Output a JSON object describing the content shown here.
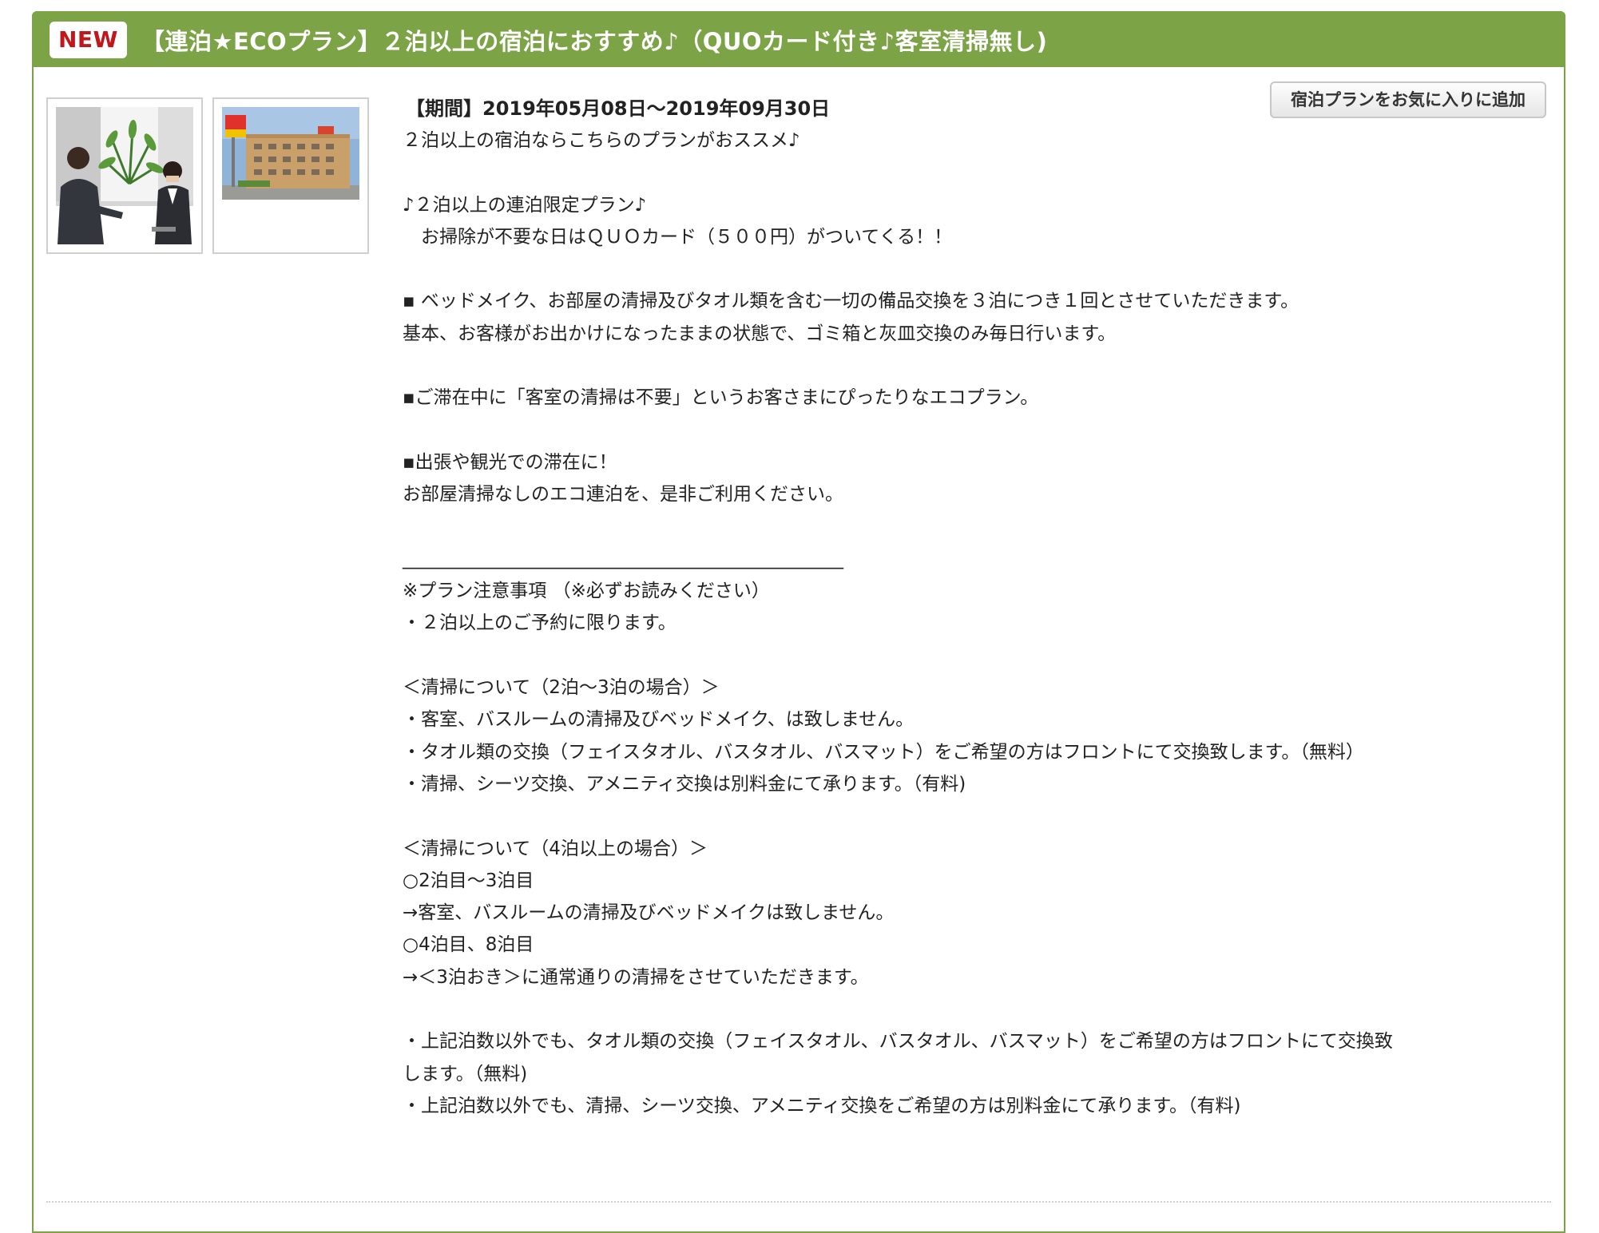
{
  "plan": {
    "badge": "NEW",
    "title": "【連泊★ECOプラン】２泊以上の宿泊におすすめ♪（QUOカード付き♪客室清掃無し)",
    "favorite_button": "宿泊プランをお気に入りに追加",
    "period": "【期間】2019年05月08日〜2019年09月30日",
    "description_lines": [
      "２泊以上の宿泊ならこちらのプランがおススメ♪",
      "",
      "♪２泊以上の連泊限定プラン♪",
      "　お掃除が不要な日はＱＵＯカード（５００円）がついてくる！！",
      "",
      "▪ ベッドメイク、お部屋の清掃及びタオル類を含む一切の備品交換を３泊につき１回とさせていただきます。",
      "基本、お客様がお出かけになったままの状態で、ゴミ箱と灰皿交換のみ毎日行います。",
      "",
      "▪ご滞在中に「客室の清掃は不要」というお客さまにぴったりなエコプラン。",
      "",
      "▪出張や観光での滞在に！",
      "お部屋清掃なしのエコ連泊を、是非ご利用ください。",
      "",
      "________________________________________________",
      "※プラン注意事項 （※必ずお読みください）",
      "・２泊以上のご予約に限ります。",
      "",
      "＜清掃について（2泊〜3泊の場合）＞",
      "・客室、バスルームの清掃及びベッドメイク、は致しません。",
      "・タオル類の交換（フェイスタオル、バスタオル、バスマット）をご希望の方はフロントにて交換致します。（無料）",
      "・清掃、シーツ交換、アメニティ交換は別料金にて承ります。（有料)",
      "",
      "＜清掃について（4泊以上の場合）＞",
      "○2泊目〜3泊目",
      "→客室、バスルームの清掃及びベッドメイクは致しません。",
      "○4泊目、8泊目",
      "→＜3泊おき＞に通常通りの清掃をさせていただきます。",
      "",
      "・上記泊数以外でも、タオル類の交換（フェイスタオル、バスタオル、バスマット）をご希望の方はフロントにて交換致",
      "します。（無料)",
      "・上記泊数以外でも、清掃、シーツ交換、アメニティ交換をご希望の方は別料金にて承ります。（有料)"
    ]
  },
  "colors": {
    "header_green": "#7ca346",
    "badge_red": "#c0161c"
  },
  "icons": {
    "thumbnail_1": "front-desk-photo",
    "thumbnail_2": "hotel-building-photo"
  }
}
